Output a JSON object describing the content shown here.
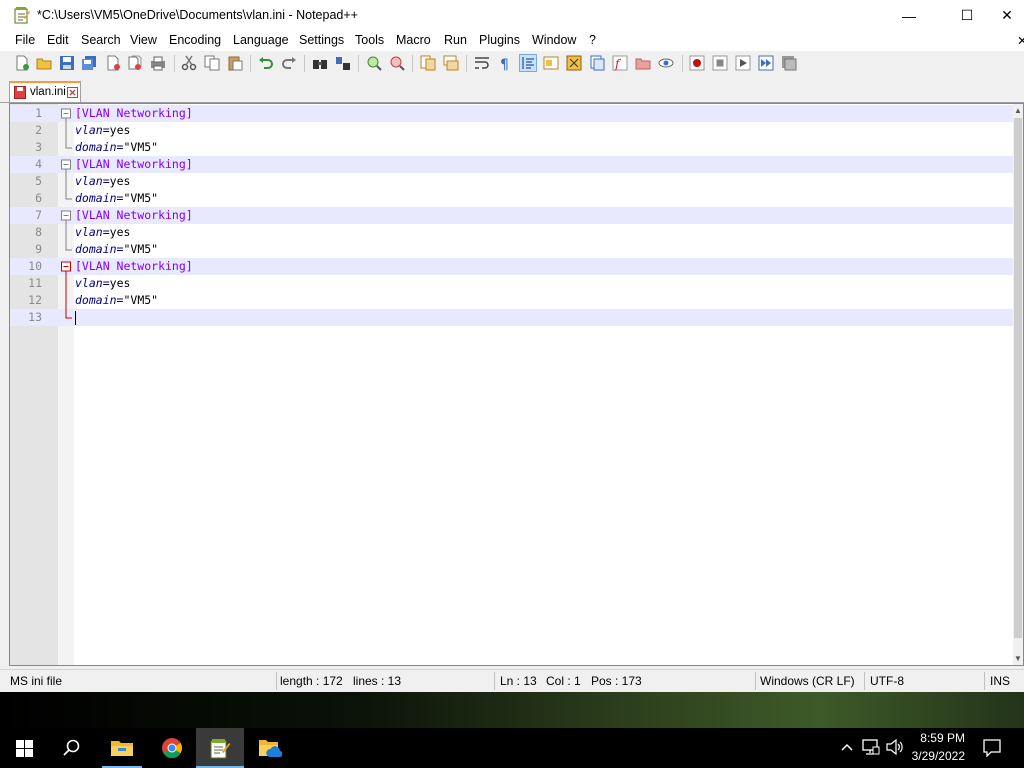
{
  "window": {
    "title": "*C:\\Users\\VM5\\OneDrive\\Documents\\vlan.ini - Notepad++",
    "minimize": "—",
    "maximize": "☐",
    "close": "✕",
    "overflow_close": "✕"
  },
  "menu": [
    "File",
    "Edit",
    "Search",
    "View",
    "Encoding",
    "Language",
    "Settings",
    "Tools",
    "Macro",
    "Run",
    "Plugins",
    "Window",
    "?"
  ],
  "toolbar": {
    "icons": [
      "new-file-icon",
      "open-file-icon",
      "save-icon",
      "save-all-icon",
      "close-icon",
      "close-all-icon",
      "print-icon",
      "cut-icon",
      "copy-icon",
      "paste-icon",
      "undo-icon",
      "redo-icon",
      "find-icon",
      "replace-icon",
      "zoom-in-icon",
      "zoom-out-icon",
      "sync-vertical-icon",
      "sync-horizontal-icon",
      "word-wrap-icon",
      "show-all-chars-icon",
      "indent-guide-icon",
      "user-defined-lang-icon",
      "doc-map-icon",
      "doc-list-icon",
      "function-list-icon",
      "folder-workspace-icon",
      "monitoring-icon",
      "record-macro-icon",
      "stop-record-icon",
      "playback-macro-icon",
      "run-macro-multiple-icon",
      "save-macro-icon"
    ]
  },
  "tab": {
    "label": "vlan.ini"
  },
  "editor": {
    "lines": [
      {
        "num": "1",
        "type": "section",
        "text": "[VLAN Networking]"
      },
      {
        "num": "2",
        "type": "kv",
        "key": "vlan",
        "eq": "=",
        "val": "yes"
      },
      {
        "num": "3",
        "type": "kv",
        "key": "domain",
        "eq": "=",
        "val": "\"VM5\""
      },
      {
        "num": "4",
        "type": "section",
        "text": "[VLAN Networking]"
      },
      {
        "num": "5",
        "type": "kv",
        "key": "vlan",
        "eq": "=",
        "val": "yes"
      },
      {
        "num": "6",
        "type": "kv",
        "key": "domain",
        "eq": "=",
        "val": "\"VM5\""
      },
      {
        "num": "7",
        "type": "section",
        "text": "[VLAN Networking]"
      },
      {
        "num": "8",
        "type": "kv",
        "key": "vlan",
        "eq": "=",
        "val": "yes"
      },
      {
        "num": "9",
        "type": "kv",
        "key": "domain",
        "eq": "=",
        "val": "\"VM5\""
      },
      {
        "num": "10",
        "type": "section",
        "text": "[VLAN Networking]"
      },
      {
        "num": "11",
        "type": "kv",
        "key": "vlan",
        "eq": "=",
        "val": "yes"
      },
      {
        "num": "12",
        "type": "kv",
        "key": "domain",
        "eq": "=",
        "val": "\"VM5\""
      },
      {
        "num": "13",
        "type": "empty",
        "text": ""
      }
    ],
    "current_line": "13"
  },
  "statusbar": {
    "file_type": "MS ini file",
    "length": "length : 172",
    "lines": "lines : 13",
    "ln": "Ln : 13",
    "col": "Col : 1",
    "pos": "Pos : 173",
    "eol": "Windows (CR LF)",
    "encoding": "UTF-8",
    "mode": "INS"
  },
  "taskbar": {
    "apps": [
      "start-icon",
      "search-icon",
      "file-explorer-icon",
      "chrome-icon",
      "notepadpp-icon",
      "onedrive-folder-icon"
    ],
    "time": "8:59 PM",
    "date": "3/29/2022"
  },
  "colors": {
    "section": "#8000ff",
    "key": "#000080",
    "current_line_bg": "#e8e8ff",
    "tab_accent": "#fa9a3c",
    "fold_red": "#cc0000"
  }
}
